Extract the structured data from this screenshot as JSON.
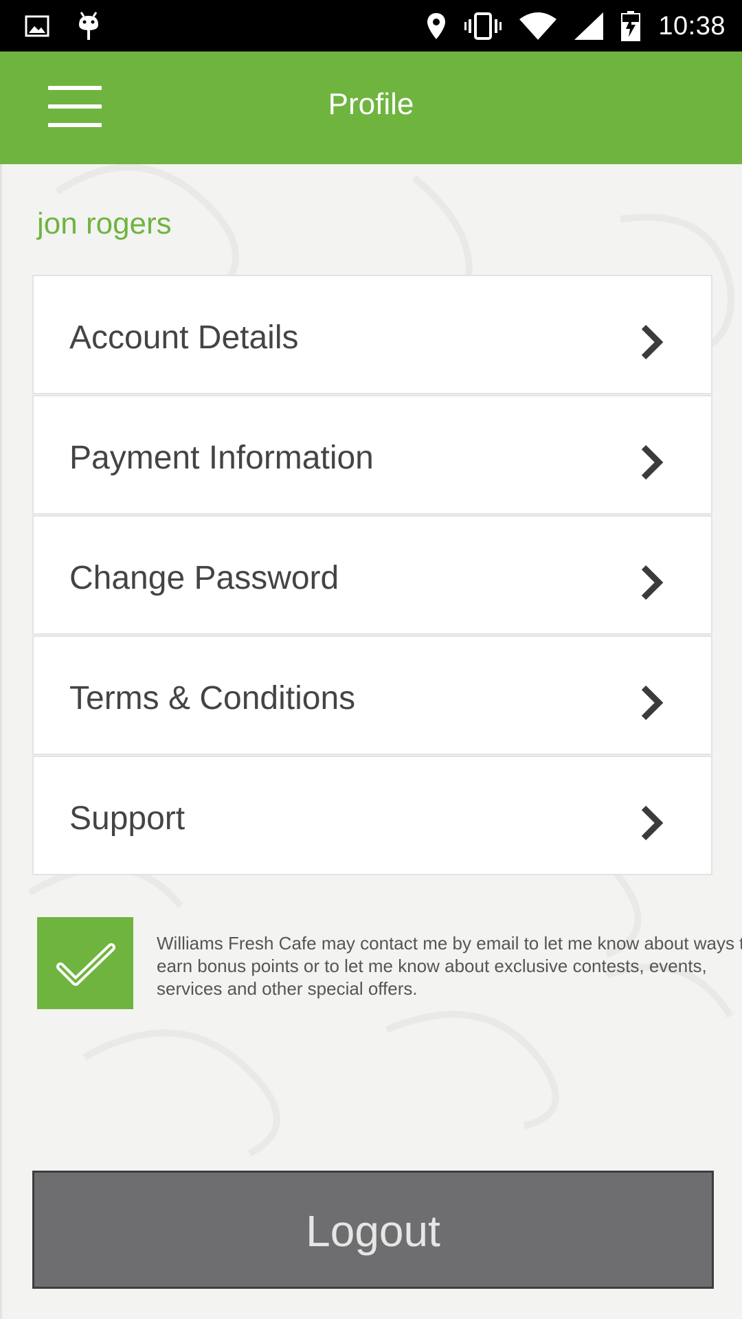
{
  "status_bar": {
    "time": "10:38",
    "left_icons": [
      "image-icon",
      "android-debug-icon"
    ],
    "right_icons": [
      "location-icon",
      "vibrate-icon",
      "wifi-icon",
      "signal-icon",
      "battery-charging-icon"
    ]
  },
  "app_bar": {
    "title": "Profile",
    "menu_icon": "hamburger-menu-icon",
    "color": "#70b440"
  },
  "profile": {
    "username": "jon rogers",
    "menu_items": [
      {
        "label": "Account Details",
        "icon": "chevron-right-icon"
      },
      {
        "label": "Payment Information",
        "icon": "chevron-right-icon"
      },
      {
        "label": "Change Password",
        "icon": "chevron-right-icon"
      },
      {
        "label": "Terms & Conditions",
        "icon": "chevron-right-icon"
      },
      {
        "label": "Support",
        "icon": "chevron-right-icon"
      }
    ]
  },
  "consent": {
    "checked": true,
    "text": "Williams Fresh Cafe may contact me by email to let me know about ways to earn bonus points or to let me know about exclusive contests, events, services and other special offers."
  },
  "logout": {
    "label": "Logout"
  },
  "colors": {
    "accent": "#70b440",
    "logout_bg": "#6e6e70"
  }
}
